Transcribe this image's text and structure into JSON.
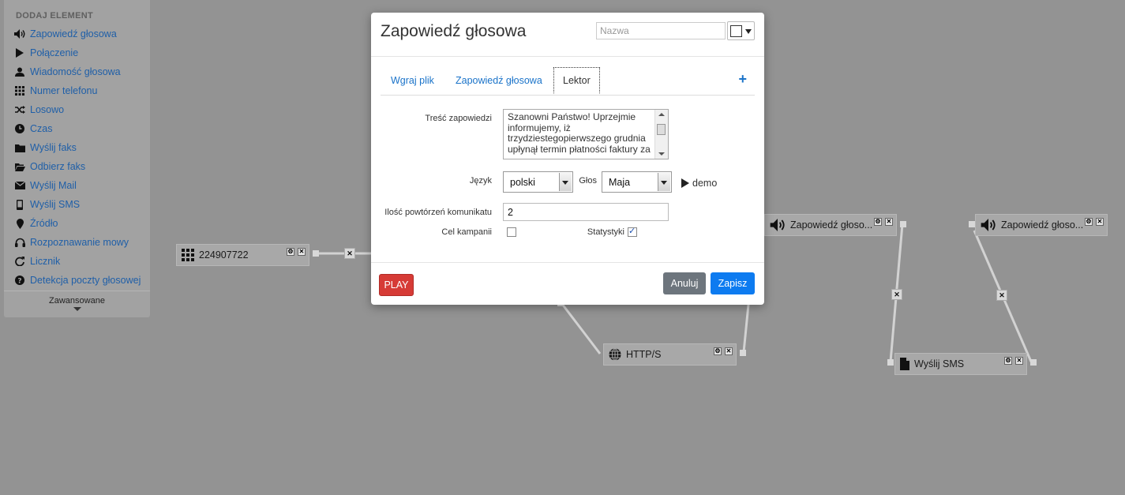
{
  "sidebar": {
    "heading": "DODAJ ELEMENT",
    "items": [
      {
        "label": "Zapowiedź głosowa",
        "icon": "speaker-icon"
      },
      {
        "label": "Połączenie",
        "icon": "play-icon"
      },
      {
        "label": "Wiadomość głosowa",
        "icon": "user-icon"
      },
      {
        "label": "Numer telefonu",
        "icon": "grid-icon"
      },
      {
        "label": "Losowo",
        "icon": "shuffle-icon"
      },
      {
        "label": "Czas",
        "icon": "clock-icon"
      },
      {
        "label": "Wyślij faks",
        "icon": "folder-icon"
      },
      {
        "label": "Odbierz faks",
        "icon": "folder-open-icon"
      },
      {
        "label": "Wyślij Mail",
        "icon": "envelope-icon"
      },
      {
        "label": "Wyślij SMS",
        "icon": "mobile-icon"
      },
      {
        "label": "Źródło",
        "icon": "map-marker-icon"
      },
      {
        "label": "Rozpoznawanie mowy",
        "icon": "headphones-icon"
      },
      {
        "label": "Licznik",
        "icon": "refresh-icon"
      },
      {
        "label": "Detekcja poczty głosowej",
        "icon": "question-circle-icon"
      }
    ],
    "advanced_label": "Zawansowane"
  },
  "canvas": {
    "nodes": {
      "phone": "224907722",
      "http": "HTTP/S",
      "announce1": "Zapowiedź głoso...",
      "announce2": "Zapowiedź głoso...",
      "sms": "Wyślij SMS"
    },
    "ctrl_gear": "⚙",
    "ctrl_close": "✕"
  },
  "modal": {
    "title": "Zapowiedź głosowa",
    "name_placeholder": "Nazwa",
    "color_value": "#ffffff",
    "tabs": [
      "Wgraj plik",
      "Zapowiedź głosowa",
      "Lektor"
    ],
    "active_tab": "Lektor",
    "add_symbol": "+",
    "content_label": "Treść zapowiedzi",
    "content_text": "Szanowni Państwo! Uprzejmie informujemy, iż trzydziestegopierwszego grudnia upłynął termin płatności faktury za",
    "language_label": "Język",
    "language_value": "polski",
    "voice_label": "Głos",
    "voice_value": "Maja",
    "demo_label": "demo",
    "repeat_label": "Ilość powtórzeń komunikatu",
    "repeat_value": "2",
    "campaign_goal_label": "Cel kampanii",
    "campaign_goal_checked": false,
    "stats_label": "Statystyki",
    "stats_checked": true,
    "play_label": "PLAY",
    "cancel_label": "Anuluj",
    "save_label": "Zapisz"
  }
}
